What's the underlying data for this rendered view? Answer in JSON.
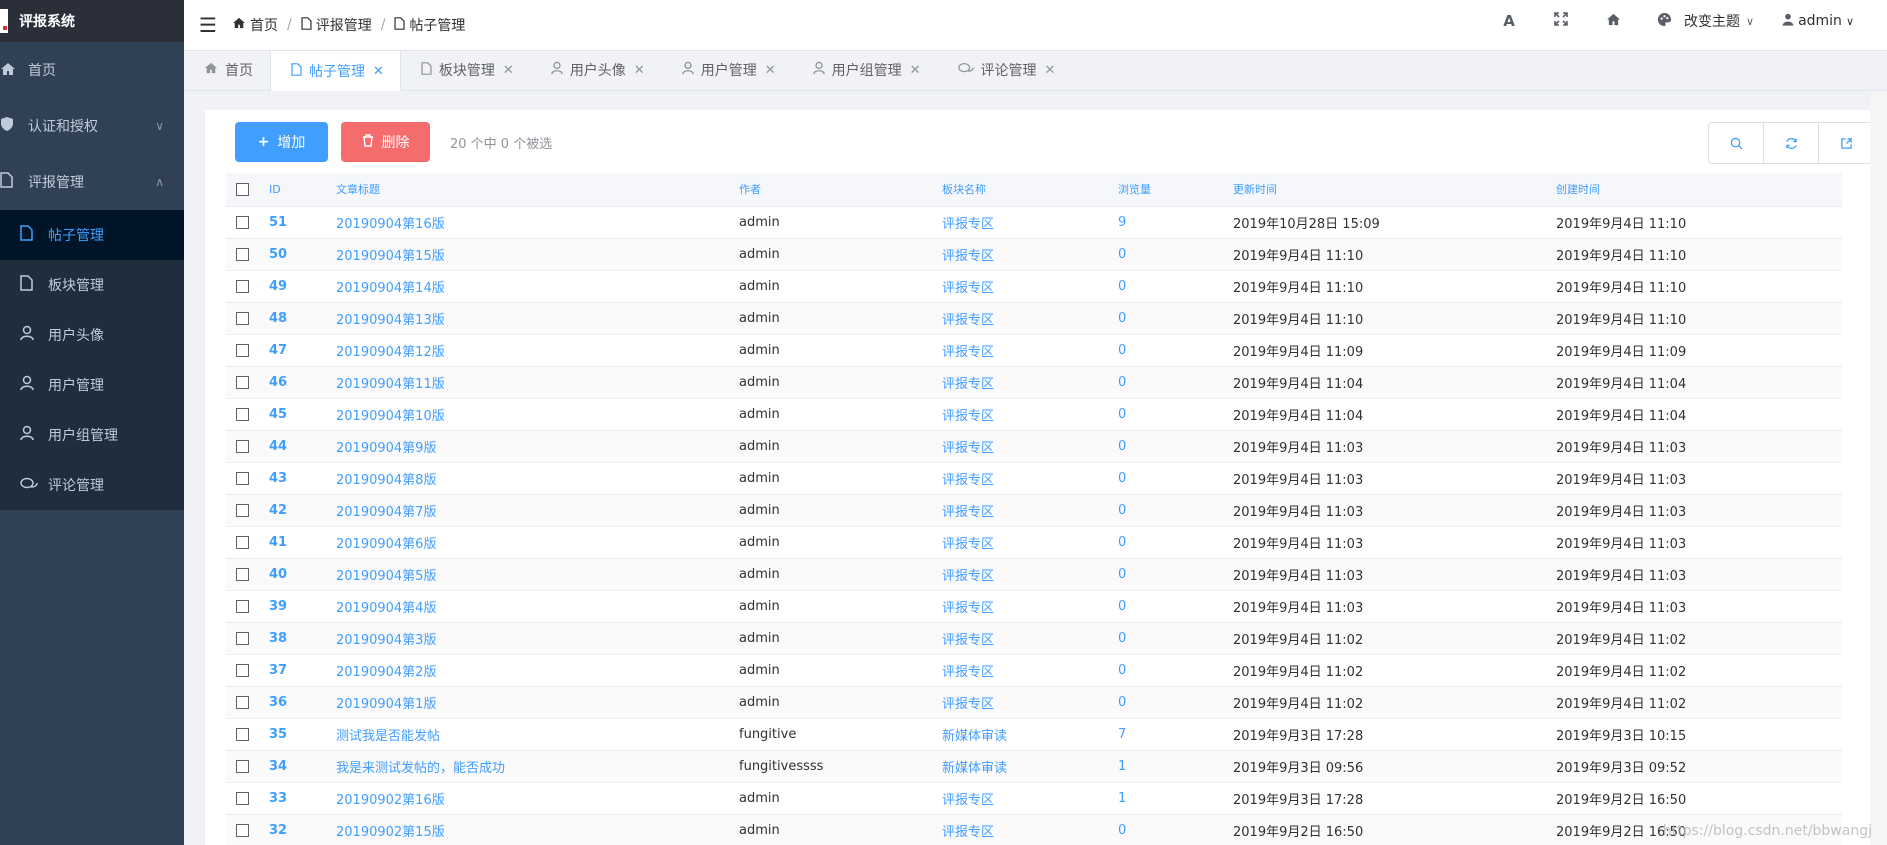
{
  "sidebar": {
    "logo": "评报系统",
    "items": [
      {
        "label": "首页",
        "icon": "home-icon"
      },
      {
        "label": "认证和授权",
        "icon": "shield-icon"
      },
      {
        "label": "评报管理",
        "icon": "document-icon"
      }
    ],
    "submenu": [
      {
        "label": "帖子管理",
        "icon": "document-icon",
        "active": true
      },
      {
        "label": "板块管理",
        "icon": "document-icon"
      },
      {
        "label": "用户头像",
        "icon": "user-icon"
      },
      {
        "label": "用户管理",
        "icon": "user-icon"
      },
      {
        "label": "用户组管理",
        "icon": "user-icon"
      },
      {
        "label": "评论管理",
        "icon": "comment-icon"
      }
    ]
  },
  "breadcrumb": [
    "首页",
    "评报管理",
    "帖子管理"
  ],
  "navbar": {
    "theme_label": "改变主题",
    "user": "admin"
  },
  "tabs": [
    {
      "label": "首页",
      "icon": "home-icon"
    },
    {
      "label": "帖子管理",
      "icon": "document-icon",
      "active": true
    },
    {
      "label": "板块管理",
      "icon": "document-icon"
    },
    {
      "label": "用户头像",
      "icon": "user-icon"
    },
    {
      "label": "用户管理",
      "icon": "user-icon"
    },
    {
      "label": "用户组管理",
      "icon": "user-icon"
    },
    {
      "label": "评论管理",
      "icon": "comment-icon"
    }
  ],
  "toolbar": {
    "add_label": "增加",
    "delete_label": "删除",
    "selection_info": "20 个中 0 个被选"
  },
  "table": {
    "headers": [
      "ID",
      "文章标题",
      "作者",
      "板块名称",
      "浏览量",
      "更新时间",
      "创建时间"
    ],
    "rows": [
      [
        "51",
        "20190904第16版",
        "admin",
        "评报专区",
        "9",
        "2019年10月28日 15:09",
        "2019年9月4日 11:10"
      ],
      [
        "50",
        "20190904第15版",
        "admin",
        "评报专区",
        "0",
        "2019年9月4日 11:10",
        "2019年9月4日 11:10"
      ],
      [
        "49",
        "20190904第14版",
        "admin",
        "评报专区",
        "0",
        "2019年9月4日 11:10",
        "2019年9月4日 11:10"
      ],
      [
        "48",
        "20190904第13版",
        "admin",
        "评报专区",
        "0",
        "2019年9月4日 11:10",
        "2019年9月4日 11:10"
      ],
      [
        "47",
        "20190904第12版",
        "admin",
        "评报专区",
        "0",
        "2019年9月4日 11:09",
        "2019年9月4日 11:09"
      ],
      [
        "46",
        "20190904第11版",
        "admin",
        "评报专区",
        "0",
        "2019年9月4日 11:04",
        "2019年9月4日 11:04"
      ],
      [
        "45",
        "20190904第10版",
        "admin",
        "评报专区",
        "0",
        "2019年9月4日 11:04",
        "2019年9月4日 11:04"
      ],
      [
        "44",
        "20190904第9版",
        "admin",
        "评报专区",
        "0",
        "2019年9月4日 11:03",
        "2019年9月4日 11:03"
      ],
      [
        "43",
        "20190904第8版",
        "admin",
        "评报专区",
        "0",
        "2019年9月4日 11:03",
        "2019年9月4日 11:03"
      ],
      [
        "42",
        "20190904第7版",
        "admin",
        "评报专区",
        "0",
        "2019年9月4日 11:03",
        "2019年9月4日 11:03"
      ],
      [
        "41",
        "20190904第6版",
        "admin",
        "评报专区",
        "0",
        "2019年9月4日 11:03",
        "2019年9月4日 11:03"
      ],
      [
        "40",
        "20190904第5版",
        "admin",
        "评报专区",
        "0",
        "2019年9月4日 11:03",
        "2019年9月4日 11:03"
      ],
      [
        "39",
        "20190904第4版",
        "admin",
        "评报专区",
        "0",
        "2019年9月4日 11:03",
        "2019年9月4日 11:03"
      ],
      [
        "38",
        "20190904第3版",
        "admin",
        "评报专区",
        "0",
        "2019年9月4日 11:02",
        "2019年9月4日 11:02"
      ],
      [
        "37",
        "20190904第2版",
        "admin",
        "评报专区",
        "0",
        "2019年9月4日 11:02",
        "2019年9月4日 11:02"
      ],
      [
        "36",
        "20190904第1版",
        "admin",
        "评报专区",
        "0",
        "2019年9月4日 11:02",
        "2019年9月4日 11:02"
      ],
      [
        "35",
        "测试我是否能发帖",
        "fungitive",
        "新媒体审读",
        "7",
        "2019年9月3日 17:28",
        "2019年9月3日 10:15"
      ],
      [
        "34",
        "我是来测试发帖的，能否成功",
        "fungitivessss",
        "新媒体审读",
        "1",
        "2019年9月3日 09:56",
        "2019年9月3日 09:52"
      ],
      [
        "33",
        "20190902第16版",
        "admin",
        "评报专区",
        "1",
        "2019年9月3日 17:28",
        "2019年9月2日 16:50"
      ],
      [
        "32",
        "20190902第15版",
        "admin",
        "评报专区",
        "0",
        "2019年9月2日 16:50",
        "2019年9月2日 16:50"
      ]
    ]
  },
  "watermark": "https://blog.csdn.net/bbwangj",
  "colors": {
    "sidebar_bg": "#304156",
    "accent": "#409eff",
    "danger": "#f56c6c"
  }
}
